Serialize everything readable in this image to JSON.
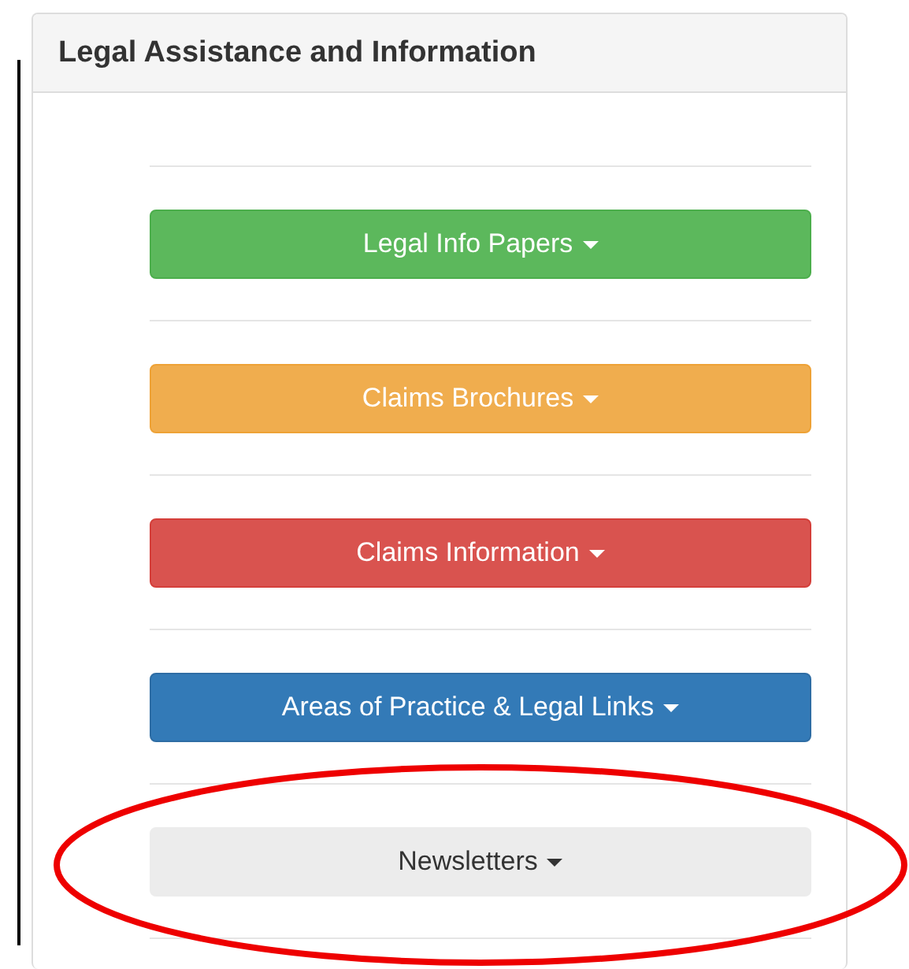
{
  "panel": {
    "title": "Legal Assistance and Information"
  },
  "buttons": [
    {
      "label": "Legal Info Papers",
      "kind": "success",
      "circled": false
    },
    {
      "label": "Claims Brochures",
      "kind": "warning",
      "circled": false
    },
    {
      "label": "Claims Information",
      "kind": "danger",
      "circled": false
    },
    {
      "label": "Areas of Practice & Legal Links",
      "kind": "primary",
      "circled": false
    },
    {
      "label": "Newsletters",
      "kind": "default",
      "circled": true
    }
  ]
}
